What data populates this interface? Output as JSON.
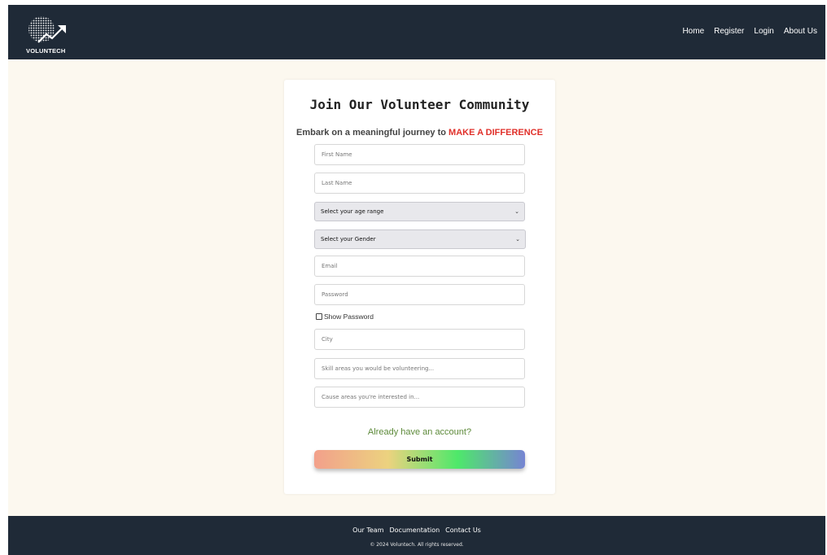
{
  "header": {
    "logo_text": "VOLUNTECH",
    "nav": [
      {
        "label": "Home"
      },
      {
        "label": "Register"
      },
      {
        "label": "Login"
      },
      {
        "label": "About Us"
      }
    ]
  },
  "form": {
    "title": "Join Our Volunteer Community",
    "subtitle_prefix": "Embark on a meaningful journey to ",
    "subtitle_accent": "MAKE A DIFFERENCE",
    "first_name_placeholder": "First Name",
    "last_name_placeholder": "Last Name",
    "age_range_selected": "Select your age range",
    "gender_selected": "Select your Gender",
    "email_placeholder": "Email",
    "password_placeholder": "Password",
    "show_password_label": "Show Password",
    "city_placeholder": "City",
    "skills_placeholder": "Skill areas you would be volunteering...",
    "causes_placeholder": "Cause areas you're interested in...",
    "account_link": "Already have an account?",
    "submit_label": "Submit"
  },
  "footer": {
    "links": [
      {
        "label": "Our Team"
      },
      {
        "label": "Documentation"
      },
      {
        "label": "Contact Us"
      }
    ],
    "copyright": "© 2024 Voluntech. All rights reserved."
  },
  "colors": {
    "header_bg": "#1f2a37",
    "page_bg": "#fcf8ef",
    "accent": "#e0302a",
    "link": "#5d8a3a"
  },
  "icons": {
    "logo": "globe-with-arrow-icon",
    "dropdown": "chevron-down-icon"
  }
}
